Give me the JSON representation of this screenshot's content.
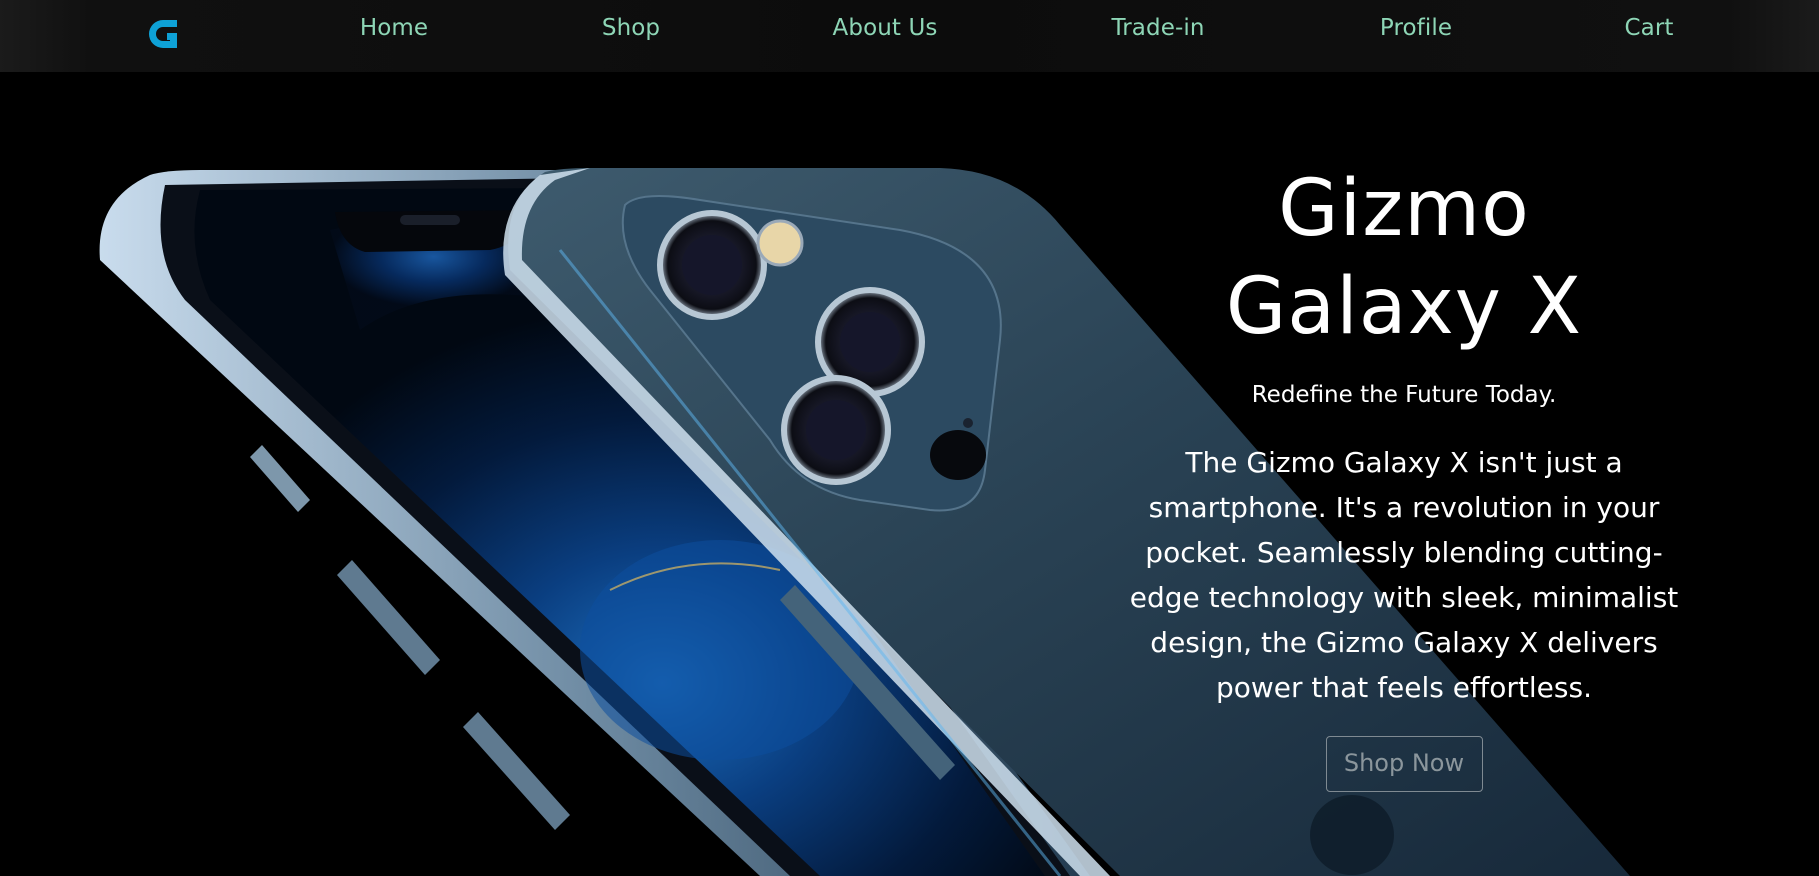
{
  "brand": {
    "logo_icon": "g-logo-icon",
    "accent_color": "#0ea1d6"
  },
  "nav": {
    "items": [
      {
        "label": "Home"
      },
      {
        "label": "Shop"
      },
      {
        "label": "About Us"
      },
      {
        "label": "Trade-in"
      },
      {
        "label": "Profile"
      },
      {
        "label": "Cart"
      }
    ],
    "text_color": "#8ed6b6"
  },
  "hero": {
    "title_line1": "Gizmo",
    "title_line2": "Galaxy X",
    "tagline": "Redefine the Future Today.",
    "description": "The Gizmo Galaxy X isn't just a smartphone. It's a revolution in your pocket. Seamlessly blending cutting-edge technology with sleek, minimalist design, the Gizmo Galaxy X delivers power that feels effortless.",
    "cta_label": "Shop Now",
    "product_image": "smartphone-pair-illustration"
  }
}
